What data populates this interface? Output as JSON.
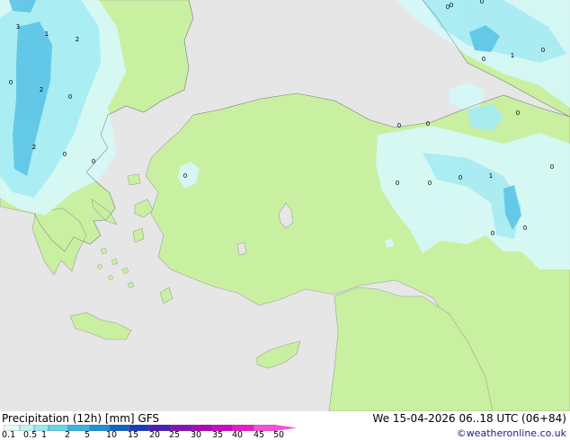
{
  "title": "Precipitation (12h) [mm] GFS",
  "validity": "We 15-04-2026 06..18 UTC (06+84)",
  "credit": "©weatheronline.co.uk",
  "legend": {
    "ticks": [
      "0.1",
      "0.5",
      "1",
      "2",
      "5",
      "10",
      "15",
      "20",
      "25",
      "30",
      "35",
      "40",
      "45",
      "50"
    ],
    "colors": [
      "#e6fafa",
      "#c0f4f4",
      "#96eaf0",
      "#69d2e6",
      "#3cb4dc",
      "#2090d2",
      "#1464be",
      "#1e3cb4",
      "#4b1eaf",
      "#8214b4",
      "#aa0ab9",
      "#cd0ac3",
      "#e61ec8",
      "#f550d7"
    ]
  },
  "colors": {
    "land": "#c8f0a0",
    "sea": "#e6e6e6",
    "coastline": "#a0a0a0",
    "precip_light": "#d6f8f8",
    "precip_mid": "#a8ecf2",
    "precip_heavy": "#5cc4e6"
  },
  "map_values": [
    "3",
    "1",
    "2",
    "2",
    "2",
    "1",
    "1",
    "0",
    "0",
    "0",
    "0",
    "0",
    "0",
    "0",
    "0",
    "0",
    "0",
    "0",
    "0",
    "0",
    "0",
    "0",
    "0",
    "0",
    "0",
    "0"
  ]
}
